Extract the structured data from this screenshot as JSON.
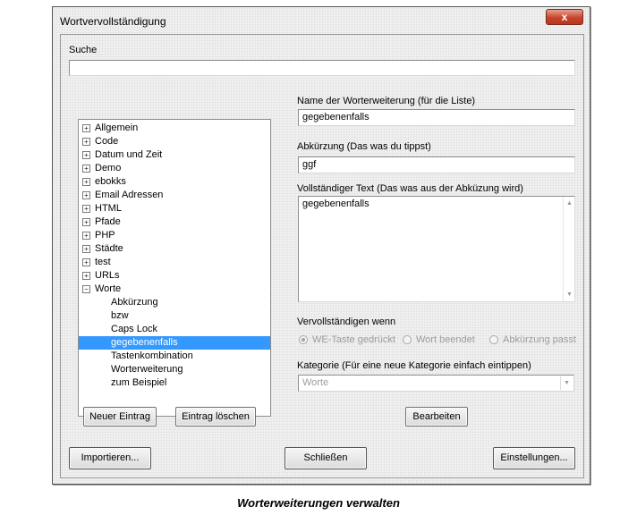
{
  "window": {
    "title": "Wortvervollständigung",
    "close_label": "x"
  },
  "search": {
    "label": "Suche",
    "value": ""
  },
  "tree": {
    "categories": [
      {
        "label": "Allgemein",
        "expanded": false
      },
      {
        "label": "Code",
        "expanded": false
      },
      {
        "label": "Datum und Zeit",
        "expanded": false
      },
      {
        "label": "Demo",
        "expanded": false
      },
      {
        "label": "ebokks",
        "expanded": false
      },
      {
        "label": "Email Adressen",
        "expanded": false
      },
      {
        "label": "HTML",
        "expanded": false
      },
      {
        "label": "Pfade",
        "expanded": false
      },
      {
        "label": "PHP",
        "expanded": false
      },
      {
        "label": "Städte",
        "expanded": false
      },
      {
        "label": "test",
        "expanded": false
      },
      {
        "label": "URLs",
        "expanded": false
      },
      {
        "label": "Worte",
        "expanded": true
      }
    ],
    "children": [
      "Abkürzung",
      "bzw",
      "Caps Lock",
      "gegebenenfalls",
      "Tastenkombination",
      "Worterweiterung",
      "zum Beispiel"
    ],
    "selected": "gegebenenfalls"
  },
  "form": {
    "name_label": "Name der Worterweiterung (für die Liste)",
    "name_value": "gegebenenfalls",
    "abbr_label": "Abkürzung (Das was du tippst)",
    "abbr_value": "ggf",
    "fulltext_label": "Vollständiger Text (Das was aus der Abküzung wird)",
    "fulltext_value": "gegebenenfalls",
    "complete_when_label": "Vervollständigen wenn",
    "radio_options": [
      "WE-Taste gedrückt",
      "Wort beendet",
      "Abkürzung passt"
    ],
    "radio_selected_index": 0,
    "category_label": "Kategorie (Für eine neue Kategorie einfach eintippen)",
    "category_value": "Worte"
  },
  "buttons": {
    "new_entry": "Neuer Eintrag",
    "delete_entry": "Eintrag löschen",
    "edit": "Bearbeiten",
    "import": "Importieren...",
    "close": "Schließen",
    "settings": "Einstellungen..."
  },
  "caption": "Worterweiterungen verwalten"
}
